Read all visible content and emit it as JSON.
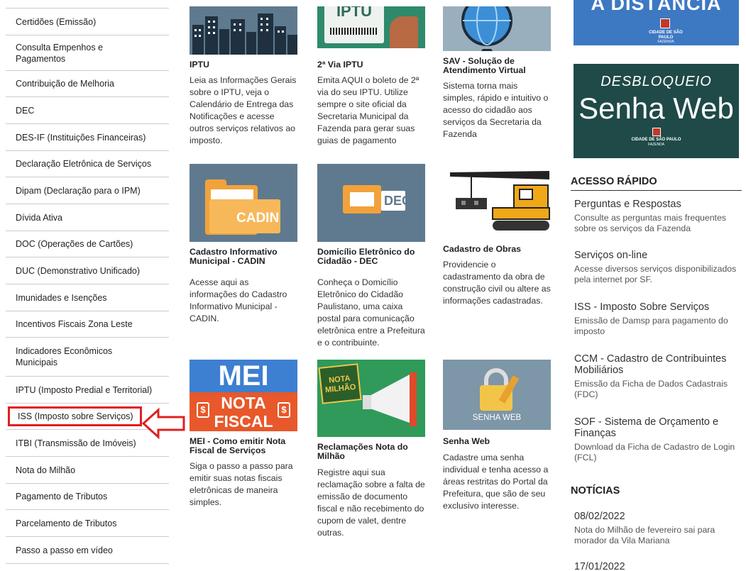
{
  "sidebar": {
    "items": [
      {
        "label": "Certidões (Emissão)"
      },
      {
        "label": "Consulta Empenhos e Pagamentos"
      },
      {
        "label": "Contribuição de Melhoria"
      },
      {
        "label": "DEC"
      },
      {
        "label": "DES-IF (Instituições Financeiras)"
      },
      {
        "label": "Declaração Eletrônica de Serviços"
      },
      {
        "label": "Dipam (Declaração para o IPM)"
      },
      {
        "label": "Dívida Ativa"
      },
      {
        "label": "DOC (Operações de Cartões)"
      },
      {
        "label": "DUC (Demonstrativo Unificado)"
      },
      {
        "label": "Imunidades e Isenções"
      },
      {
        "label": "Incentivos Fiscais Zona Leste"
      },
      {
        "label": "Indicadores Econômicos Municipais"
      },
      {
        "label": "IPTU (Imposto Predial e Territorial)"
      },
      {
        "label": "ISS (Imposto sobre Serviços)"
      },
      {
        "label": "ITBI (Transmissão de Imóveis)"
      },
      {
        "label": "Nota do Milhão"
      },
      {
        "label": "Pagamento de Tributos"
      },
      {
        "label": "Parcelamento de Tributos"
      },
      {
        "label": "Passo a passo em vídeo"
      }
    ]
  },
  "cards": {
    "iptu": {
      "title": "IPTU",
      "desc": "Leia as Informações Gerais sobre o IPTU, veja o Calendário de Entrega das Notificações e acesse outros serviços relativos ao imposto."
    },
    "iptu2": {
      "title": "2ª Via IPTU",
      "desc": "Emita AQUI o boleto de 2ª via do seu IPTU. Utilize sempre o site oficial da Secretaria Municipal da Fazenda para gerar suas guias de pagamento",
      "thumb_text": "IPTU"
    },
    "sav": {
      "title": "SAV - Solução de Atendimento Virtual",
      "desc": "Sistema torna mais simples, rápido e intuitivo o acesso do cidadão aos serviços da Secretaria da Fazenda"
    },
    "cadin": {
      "title": "Cadastro Informativo Municipal - CADIN",
      "desc": "Acesse aqui as informações do Cadastro Informativo Municipal - CADIN.",
      "thumb_text": "CADIN"
    },
    "dec": {
      "title": "Domicílio Eletrônico do Cidadão - DEC",
      "desc": "Conheça o Domicílio Eletrônico do Cidadão Paulistano, uma caixa postal para comunicação eletrônica entre a Prefeitura e o contribuinte.",
      "thumb_text": "DEC"
    },
    "obras": {
      "title": "Cadastro de Obras",
      "desc": "Providencie o cadastramento da obra de construção civil ou altere as informações cadastradas."
    },
    "mei": {
      "title": "MEI - Como emitir Nota Fiscal de Serviços",
      "desc": "Siga o passo a passo para emitir suas notas fiscais eletrônicas de maneira simples.",
      "thumb_line1": "MEI",
      "thumb_line2": "NOTA",
      "thumb_line3": "FISCAL"
    },
    "reclamacoes": {
      "title": "Reclamações Nota do Milhão",
      "desc": "Registre aqui sua reclamação sobre a falta de emissão de documento fiscal e não recebimento do cupom de valet, dentre outras.",
      "thumb_line1": "NOTA",
      "thumb_line2": "MILHÃO"
    },
    "senhaweb": {
      "title": "Senha Web",
      "desc": "Cadastre uma senha individual e tenha acesso a áreas restritas do Portal da Prefeitura, que são de seu exclusivo interesse.",
      "thumb_text": "SENHA WEB"
    }
  },
  "banners": {
    "distancia_text": "A DISTÂNCIA",
    "city_logo_text": "CIDADE DE SÃO PAULO",
    "city_logo_sub": "FAZENDA",
    "desbloqueio_line1": "DESBLOQUEIO",
    "desbloqueio_line2": "Senha Web"
  },
  "acesso_rapido": {
    "title": "ACESSO RÁPIDO",
    "items": [
      {
        "title": "Perguntas e Respostas",
        "desc": "Consulte as perguntas mais frequentes sobre os serviços da Fazenda"
      },
      {
        "title": "Serviços on-line",
        "desc": "Acesse diversos serviços disponibilizados pela internet por SF."
      },
      {
        "title": "ISS - Imposto Sobre Serviços",
        "desc": "Emissão de Damsp para pagamento do imposto"
      },
      {
        "title": "CCM - Cadastro de Contribuintes Mobiliários",
        "desc": "Emissão da Ficha de Dados Cadastrais (FDC)"
      },
      {
        "title": "SOF - Sistema de Orçamento e Finanças",
        "desc": "Download da Ficha de Cadastro de Login (FCL)"
      }
    ]
  },
  "noticias": {
    "title": "NOTÍCIAS",
    "items": [
      {
        "date": "08/02/2022",
        "text": "Nota do Milhão de fevereiro sai para morador da Vila Mariana"
      },
      {
        "date": "17/01/2022",
        "text": ""
      }
    ]
  },
  "colors": {
    "highlight": "#e02020",
    "slate": "#5f7a8e",
    "orange": "#e8582a",
    "teal": "#2f8a6c",
    "banner_blue": "#3d78c2",
    "banner_green": "#1f4a47"
  }
}
